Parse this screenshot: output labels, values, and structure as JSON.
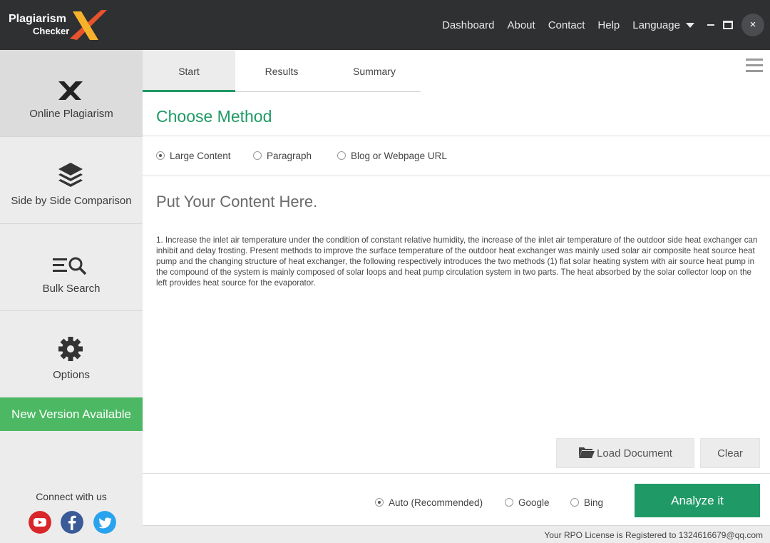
{
  "app": {
    "logo_line1": "Plagiarism",
    "logo_line2": "Checker"
  },
  "topnav": {
    "items": [
      "Dashboard",
      "About",
      "Contact",
      "Help"
    ],
    "language": "Language",
    "close_glyph": "×"
  },
  "sidebar": {
    "items": [
      {
        "label": "Online Plagiarism",
        "icon": "x-logo-icon"
      },
      {
        "label": "Side by Side Comparison",
        "icon": "layers-icon"
      },
      {
        "label": "Bulk Search",
        "icon": "list-search-icon"
      },
      {
        "label": "Options",
        "icon": "gear-icon"
      }
    ],
    "new_version": "New Version Available",
    "connect": "Connect with us"
  },
  "tabs": [
    "Start",
    "Results",
    "Summary"
  ],
  "main": {
    "title": "Choose Method",
    "methods": [
      "Large Content",
      "Paragraph",
      "Blog or Webpage URL"
    ],
    "selected_method": "Large Content",
    "content_heading": "Put Your Content Here.",
    "content_text": "1. Increase the inlet air temperature under the condition of constant relative humidity, the increase of the inlet air temperature of the outdoor side heat exchanger can inhibit and delay frosting. Present methods to improve the surface temperature of the outdoor heat exchanger was mainly used solar air composite heat source heat pump and the changing structure of heat exchanger, the following respectively introduces the two methods (1) flat solar heating system with air source heat pump in the compound of the system is mainly composed of solar loops and heat pump circulation system in two parts. The heat absorbed by the solar collector loop on the left provides heat source for the evaporator.",
    "load_button": "Load Document",
    "clear_button": "Clear",
    "engines": [
      "Auto (Recommended)",
      "Google",
      "Bing"
    ],
    "selected_engine": "Auto (Recommended)",
    "analyze_button": "Analyze it"
  },
  "status": {
    "license": "Your RPO License is Registered to 1324616679@qq.com"
  },
  "colors": {
    "accent": "#1f9a66",
    "new_version": "#4cb863",
    "titlebar": "#2e3032"
  }
}
